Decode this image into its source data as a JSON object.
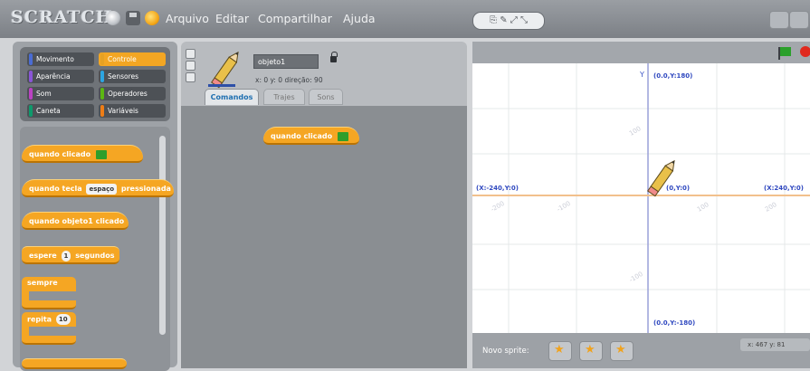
{
  "app": {
    "logo": "SCRATCH",
    "menu": [
      "Arquivo",
      "Editar",
      "Compartilhar",
      "Ajuda"
    ]
  },
  "palette": {
    "categories": [
      {
        "label": "Movimento",
        "color": "#4a6cd4"
      },
      {
        "label": "Controle",
        "color": "#e6a123",
        "active": true
      },
      {
        "label": "Aparência",
        "color": "#8a55d7"
      },
      {
        "label": "Sensores",
        "color": "#2ca5e2"
      },
      {
        "label": "Som",
        "color": "#bb42c3"
      },
      {
        "label": "Operadores",
        "color": "#5cb712"
      },
      {
        "label": "Caneta",
        "color": "#0e9a6c"
      },
      {
        "label": "Variáveis",
        "color": "#ee7d16"
      }
    ],
    "blocks": {
      "when_flag": "quando  clicado",
      "when_key_prefix": "quando tecla",
      "when_key_slot": "espaço",
      "when_key_suffix": "pressionada",
      "when_sprite_clicked": "quando objeto1 clicado",
      "wait_prefix": "espere",
      "wait_value": "1",
      "wait_suffix": "segundos",
      "forever": "sempre",
      "repeat": "repita",
      "repeat_value": "10"
    }
  },
  "sprite": {
    "name": "objeto1",
    "coords": "x: 0    y: 0    direção: 90",
    "tabs": {
      "commands": "Comandos",
      "costumes": "Trajes",
      "sounds": "Sons"
    }
  },
  "script": {
    "block": "quando  clicado"
  },
  "stage": {
    "labels": {
      "top": "(0.0,Y:180)",
      "bottom": "(0.0,Y:-180)",
      "left": "(X:-240,Y:0)",
      "right": "(X:240,Y:0)",
      "center": "(0,Y:0)",
      "y_axis": "Y"
    },
    "new_sprite_label": "Novo sprite:",
    "mouse_coords": "x: 467   y: 81"
  }
}
